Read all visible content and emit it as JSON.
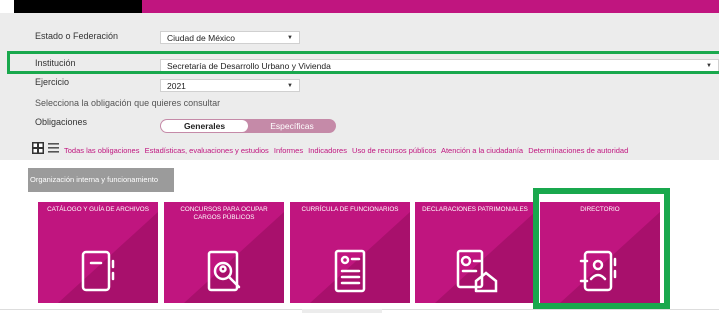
{
  "form": {
    "estado_label": "Estado o Federación",
    "estado_value": "Ciudad de México",
    "institucion_label": "Institución",
    "institucion_value": "Secretaría de Desarrollo Urbano y Vivienda",
    "ejercicio_label": "Ejercicio",
    "ejercicio_value": "2021",
    "selecciona_text": "Selecciona la obligación que quieres consultar",
    "obligaciones_label": "Obligaciones"
  },
  "toggle": {
    "generales": "Generales",
    "especificas": "Específicas"
  },
  "filters": [
    "Todas las obligaciones",
    "Estadísticas, evaluaciones y estudios",
    "Informes",
    "Indicadores",
    "Uso de recursos públicos",
    "Atención a la ciudadanía",
    "Determinaciones de autoridad"
  ],
  "org_tab": "Organización interna y funcionamiento",
  "cards": [
    {
      "title": "CATÁLOGO Y GUÍA DE ARCHIVOS",
      "icon": "notebook-icon"
    },
    {
      "title": "CONCURSOS PARA OCUPAR CARGOS PÚBLICOS",
      "icon": "document-search-icon"
    },
    {
      "title": "CURRÍCULA DE FUNCIONARIOS",
      "icon": "resume-icon"
    },
    {
      "title": "DECLARACIONES PATRIMONIALES",
      "icon": "property-declaration-icon"
    },
    {
      "title": "DIRECTORIO",
      "icon": "contact-directory-icon"
    }
  ],
  "colors": {
    "brand_magenta": "#c0157f",
    "highlight_green": "#19a84d",
    "panel_gray": "#ececec"
  }
}
